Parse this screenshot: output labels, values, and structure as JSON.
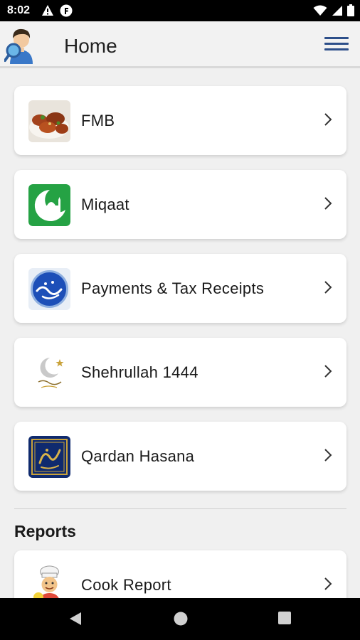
{
  "status_bar": {
    "time": "8:02",
    "icons_left": [
      "alert-icon",
      "f-app-icon"
    ],
    "icons_right": [
      "wifi-icon",
      "signal-icon",
      "battery-icon"
    ]
  },
  "app_bar": {
    "title": "Home",
    "avatar_icon": "user-search-avatar-icon",
    "menu_icon": "hamburger-menu-icon",
    "accent_color": "#2d4f8a"
  },
  "menu_items": [
    {
      "label": "FMB",
      "icon": "fmb-food-icon"
    },
    {
      "label": "Miqaat",
      "icon": "miqaat-mosque-icon"
    },
    {
      "label": "Payments & Tax Receipts",
      "icon": "sabeel-payments-icon"
    },
    {
      "label": "Shehrullah 1444",
      "icon": "ramadan-moon-icon"
    },
    {
      "label": "Qardan Hasana",
      "icon": "qardan-hasana-icon"
    }
  ],
  "reports": {
    "title": "Reports",
    "items": [
      {
        "label": "Cook Report",
        "icon": "chef-icon"
      }
    ]
  },
  "nav_bar": {
    "buttons": [
      "back-icon",
      "home-circle-icon",
      "recents-square-icon"
    ]
  }
}
